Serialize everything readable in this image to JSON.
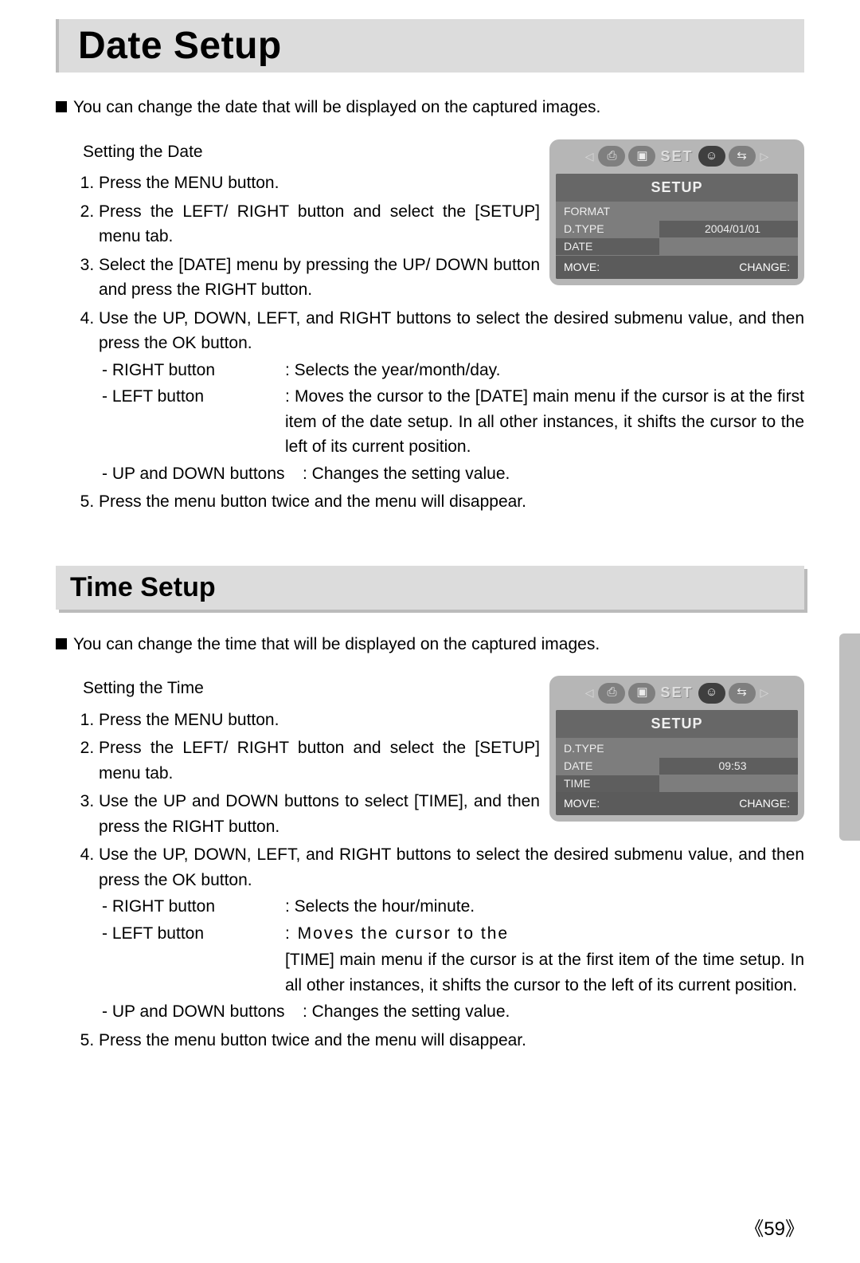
{
  "date_section": {
    "title": "Date Setup",
    "intro": "You can change the date that will be displayed on the captured images.",
    "subtitle": "Setting the Date",
    "steps": {
      "s1": "Press the MENU button.",
      "s2": "Press the LEFT/ RIGHT button and select the [SETUP] menu tab.",
      "s3": "Select the [DATE] menu by pressing the UP/ DOWN button and press the RIGHT button.",
      "s4": "Use the UP, DOWN, LEFT, and RIGHT buttons to select the desired submenu value, and then press the OK button.",
      "s4_sub_right_key": "- RIGHT button",
      "s4_sub_right_val": ": Selects the year/month/day.",
      "s4_sub_left_key": "- LEFT button",
      "s4_sub_left_val": ": Moves the cursor to the [DATE] main menu if the cursor is at the first item of the date setup. In all other instances, it shifts the cursor to the left of its current position.",
      "s4_sub_ud_key": "- UP and DOWN buttons",
      "s4_sub_ud_val": ": Changes the setting value.",
      "s5": "Press the menu button twice and the menu will disappear."
    },
    "screen": {
      "set_label": "SET",
      "header": "SETUP",
      "row1": "FORMAT",
      "row2_l": "D.TYPE",
      "row2_r": "2004/01/01",
      "row3": "DATE",
      "footer_l": "MOVE:",
      "footer_r": "CHANGE:"
    }
  },
  "time_section": {
    "title": "Time Setup",
    "intro": "You can change the time that will be displayed on the captured images.",
    "subtitle": "Setting the Time",
    "steps": {
      "s1": "Press the MENU button.",
      "s2": "Press the LEFT/ RIGHT button and select the [SETUP] menu tab.",
      "s3": "Use the UP and DOWN buttons to select [TIME], and then press the RIGHT button.",
      "s4": "Use the UP, DOWN, LEFT, and RIGHT buttons to select the desired submenu value, and then press the OK button.",
      "s4_sub_right_key": "- RIGHT button",
      "s4_sub_right_val": ": Selects the hour/minute.",
      "s4_sub_left_key": "- LEFT button",
      "s4_sub_left_val_part1": ": Moves the cursor to the",
      "s4_sub_left_val_part2": "[TIME] main menu if the cursor is at the first item of the time setup. In all other instances, it shifts the cursor to the left of its current position.",
      "s4_sub_ud_key": "- UP and DOWN buttons",
      "s4_sub_ud_val": ": Changes the setting value.",
      "s5": "Press the menu button twice and the menu will disappear."
    },
    "screen": {
      "set_label": "SET",
      "header": "SETUP",
      "row1": "D.TYPE",
      "row2_l": "DATE",
      "row2_r": "09:53",
      "row3": "TIME",
      "footer_l": "MOVE:",
      "footer_r": "CHANGE:"
    }
  },
  "page_number": "59"
}
